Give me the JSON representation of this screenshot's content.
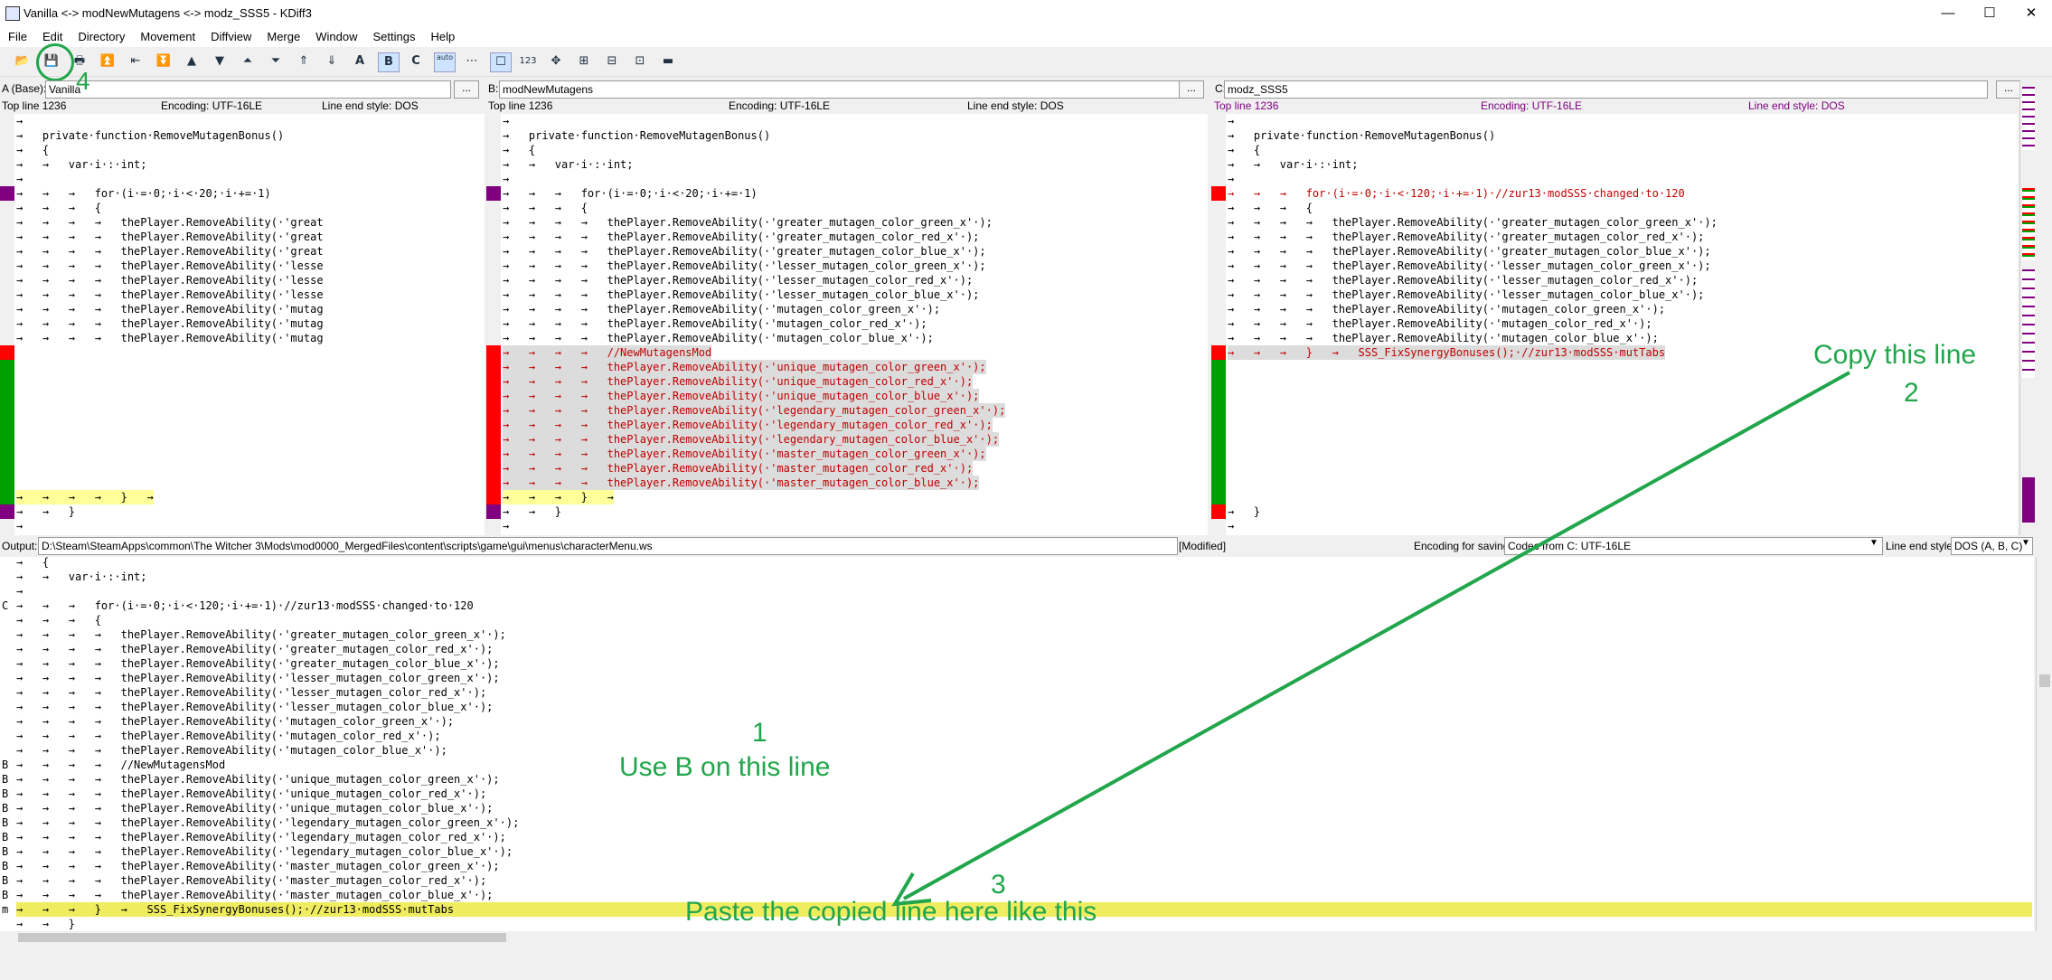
{
  "window": {
    "title": "Vanilla <-> modNewMutagens <-> modz_SSS5 - KDiff3",
    "min": "—",
    "max": "☐",
    "close": "✕"
  },
  "menu": [
    "File",
    "Edit",
    "Directory",
    "Movement",
    "Diffview",
    "Merge",
    "Window",
    "Settings",
    "Help"
  ],
  "toolbar": {
    "icons": [
      "open-icon",
      "save-icon",
      "print-icon",
      "go-top-icon",
      "prev-delta-icon",
      "next-delta-icon",
      "prev-conflict-icon",
      "next-conflict-icon",
      "go-bottom-icon",
      "prev-unsolved-icon",
      "next-unsolved-icon",
      "choose-a-icon",
      "choose-b-icon",
      "choose-c-icon",
      "auto-advance-icon",
      "show-whitespace-icon",
      "show-space-chars-icon",
      "show-line-numbers-icon",
      "overview-icon",
      "split-icon",
      "join-icon",
      "wordwrap-icon",
      "show-window-icon"
    ],
    "a_label": "A",
    "b_label": "B",
    "c_label": "C",
    "auto_label": "auto",
    "num_label": "123"
  },
  "panes": {
    "a": {
      "label": "A (Base):",
      "path": "Vanilla",
      "top_line": "Top line 1236",
      "encoding": "Encoding: UTF-16LE",
      "line_end": "Line end style: DOS"
    },
    "b": {
      "label": "B:",
      "path": "modNewMutagens",
      "top_line": "Top line 1236",
      "encoding": "Encoding: UTF-16LE",
      "line_end": "Line end style: DOS"
    },
    "c": {
      "label": "C:",
      "path": "modz_SSS5",
      "top_line": "Top line 1236",
      "encoding": "Encoding: UTF-16LE",
      "line_end": "Line end style: DOS"
    },
    "browse": "..."
  },
  "code_a": [
    "→",
    "→   private·function·RemoveMutagenBonus()",
    "→   {",
    "→   →   var·i·:·int;",
    "→",
    "→   →   →   for·(i·=·0;·i·<·20;·i·+=·1)",
    "→   →   →   {",
    "→   →   →   →   thePlayer.RemoveAbility(·'great",
    "→   →   →   →   thePlayer.RemoveAbility(·'great",
    "→   →   →   →   thePlayer.RemoveAbility(·'great",
    "→   →   →   →   thePlayer.RemoveAbility(·'lesse",
    "→   →   →   →   thePlayer.RemoveAbility(·'lesse",
    "→   →   →   →   thePlayer.RemoveAbility(·'lesse",
    "→   →   →   →   thePlayer.RemoveAbility(·'mutag",
    "→   →   →   →   thePlayer.RemoveAbility(·'mutag",
    "→   →   →   →   thePlayer.RemoveAbility(·'mutag",
    "",
    "",
    "",
    "",
    "",
    "",
    "",
    "",
    "",
    "",
    "→   →   →   →   }   →",
    "→   →   }",
    "→"
  ],
  "code_b": [
    "→",
    "→   private·function·RemoveMutagenBonus()",
    "→   {",
    "→   →   var·i·:·int;",
    "→",
    "→   →   →   for·(i·=·0;·i·<·20;·i·+=·1)",
    "→   →   →   {",
    "→   →   →   →   thePlayer.RemoveAbility(·'greater_mutagen_color_green_x'·);",
    "→   →   →   →   thePlayer.RemoveAbility(·'greater_mutagen_color_red_x'·);",
    "→   →   →   →   thePlayer.RemoveAbility(·'greater_mutagen_color_blue_x'·);",
    "→   →   →   →   thePlayer.RemoveAbility(·'lesser_mutagen_color_green_x'·);",
    "→   →   →   →   thePlayer.RemoveAbility(·'lesser_mutagen_color_red_x'·);",
    "→   →   →   →   thePlayer.RemoveAbility(·'lesser_mutagen_color_blue_x'·);",
    "→   →   →   →   thePlayer.RemoveAbility(·'mutagen_color_green_x'·);",
    "→   →   →   →   thePlayer.RemoveAbility(·'mutagen_color_red_x'·);",
    "→   →   →   →   thePlayer.RemoveAbility(·'mutagen_color_blue_x'·);",
    "→   →   →   →   //NewMutagensMod",
    "→   →   →   →   thePlayer.RemoveAbility(·'unique_mutagen_color_green_x'·);",
    "→   →   →   →   thePlayer.RemoveAbility(·'unique_mutagen_color_red_x'·);",
    "→   →   →   →   thePlayer.RemoveAbility(·'unique_mutagen_color_blue_x'·);",
    "→   →   →   →   thePlayer.RemoveAbility(·'legendary_mutagen_color_green_x'·);",
    "→   →   →   →   thePlayer.RemoveAbility(·'legendary_mutagen_color_red_x'·);",
    "→   →   →   →   thePlayer.RemoveAbility(·'legendary_mutagen_color_blue_x'·);",
    "→   →   →   →   thePlayer.RemoveAbility(·'master_mutagen_color_green_x'·);",
    "→   →   →   →   thePlayer.RemoveAbility(·'master_mutagen_color_red_x'·);",
    "→   →   →   →   thePlayer.RemoveAbility(·'master_mutagen_color_blue_x'·);",
    "→   →   →   }   →",
    "→   →   }",
    "→"
  ],
  "code_c": [
    "→",
    "→   private·function·RemoveMutagenBonus()",
    "→   {",
    "→   →   var·i·:·int;",
    "→",
    "→   →   →   for·(i·=·0;·i·<·120;·i·+=·1)·//zur13·modSSS·changed·to·120",
    "→   →   →   {",
    "→   →   →   →   thePlayer.RemoveAbility(·'greater_mutagen_color_green_x'·);",
    "→   →   →   →   thePlayer.RemoveAbility(·'greater_mutagen_color_red_x'·);",
    "→   →   →   →   thePlayer.RemoveAbility(·'greater_mutagen_color_blue_x'·);",
    "→   →   →   →   thePlayer.RemoveAbility(·'lesser_mutagen_color_green_x'·);",
    "→   →   →   →   thePlayer.RemoveAbility(·'lesser_mutagen_color_red_x'·);",
    "→   →   →   →   thePlayer.RemoveAbility(·'lesser_mutagen_color_blue_x'·);",
    "→   →   →   →   thePlayer.RemoveAbility(·'mutagen_color_green_x'·);",
    "→   →   →   →   thePlayer.RemoveAbility(·'mutagen_color_red_x'·);",
    "→   →   →   →   thePlayer.RemoveAbility(·'mutagen_color_blue_x'·);",
    "→   →   →   }   →   SSS_FixSynergyBonuses();·//zur13·modSSS·mutTabs",
    "",
    "",
    "",
    "",
    "",
    "",
    "",
    "",
    "",
    "",
    "→   }",
    "→"
  ],
  "output": {
    "label": "Output:",
    "path": "D:\\Steam\\SteamApps\\common\\The Witcher 3\\Mods\\mod0000_MergedFiles\\content\\scripts\\game\\gui\\menus\\characterMenu.ws",
    "modified": "[Modified]",
    "enc_label": "Encoding for saving:",
    "enc_value": "Codec from C: UTF-16LE",
    "lineend_label": "Line end style:",
    "lineend_value": "DOS (A, B, C)",
    "lines": [
      {
        "s": "",
        "t": "→   {"
      },
      {
        "s": "",
        "t": "→   →   var·i·:·int;"
      },
      {
        "s": "",
        "t": "→"
      },
      {
        "s": "C",
        "t": "→   →   →   for·(i·=·0;·i·<·120;·i·+=·1)·//zur13·modSSS·changed·to·120"
      },
      {
        "s": "",
        "t": "→   →   →   {"
      },
      {
        "s": "",
        "t": "→   →   →   →   thePlayer.RemoveAbility(·'greater_mutagen_color_green_x'·);"
      },
      {
        "s": "",
        "t": "→   →   →   →   thePlayer.RemoveAbility(·'greater_mutagen_color_red_x'·);"
      },
      {
        "s": "",
        "t": "→   →   →   →   thePlayer.RemoveAbility(·'greater_mutagen_color_blue_x'·);"
      },
      {
        "s": "",
        "t": "→   →   →   →   thePlayer.RemoveAbility(·'lesser_mutagen_color_green_x'·);"
      },
      {
        "s": "",
        "t": "→   →   →   →   thePlayer.RemoveAbility(·'lesser_mutagen_color_red_x'·);"
      },
      {
        "s": "",
        "t": "→   →   →   →   thePlayer.RemoveAbility(·'lesser_mutagen_color_blue_x'·);"
      },
      {
        "s": "",
        "t": "→   →   →   →   thePlayer.RemoveAbility(·'mutagen_color_green_x'·);"
      },
      {
        "s": "",
        "t": "→   →   →   →   thePlayer.RemoveAbility(·'mutagen_color_red_x'·);"
      },
      {
        "s": "",
        "t": "→   →   →   →   thePlayer.RemoveAbility(·'mutagen_color_blue_x'·);"
      },
      {
        "s": "B",
        "t": "→   →   →   →   //NewMutagensMod"
      },
      {
        "s": "B",
        "t": "→   →   →   →   thePlayer.RemoveAbility(·'unique_mutagen_color_green_x'·);"
      },
      {
        "s": "B",
        "t": "→   →   →   →   thePlayer.RemoveAbility(·'unique_mutagen_color_red_x'·);"
      },
      {
        "s": "B",
        "t": "→   →   →   →   thePlayer.RemoveAbility(·'unique_mutagen_color_blue_x'·);"
      },
      {
        "s": "B",
        "t": "→   →   →   →   thePlayer.RemoveAbility(·'legendary_mutagen_color_green_x'·);"
      },
      {
        "s": "B",
        "t": "→   →   →   →   thePlayer.RemoveAbility(·'legendary_mutagen_color_red_x'·);"
      },
      {
        "s": "B",
        "t": "→   →   →   →   thePlayer.RemoveAbility(·'legendary_mutagen_color_blue_x'·);"
      },
      {
        "s": "B",
        "t": "→   →   →   →   thePlayer.RemoveAbility(·'master_mutagen_color_green_x'·);"
      },
      {
        "s": "B",
        "t": "→   →   →   →   thePlayer.RemoveAbility(·'master_mutagen_color_red_x'·);"
      },
      {
        "s": "B",
        "t": "→   →   →   →   thePlayer.RemoveAbility(·'master_mutagen_color_blue_x'·);"
      },
      {
        "s": "m",
        "t": "→   →   →   }   →   SSS_FixSynergyBonuses();·//zur13·modSSS·mutTabs"
      },
      {
        "s": "",
        "t": "→   →   }"
      }
    ]
  },
  "annotations": {
    "copy_label": "Copy this line",
    "copy_num": "2",
    "use_b_num": "1",
    "use_b_label": "Use B on this line",
    "paste_num": "3",
    "paste_label": "Paste the copied line here like this",
    "save_num": "4"
  },
  "colors": {
    "annotation": "#21a64b",
    "diff_purple": "#800080",
    "diff_red": "#ff0000",
    "diff_green": "#00a000",
    "merge_yellow": "#ffff99",
    "output_yellow": "#f0ec60"
  }
}
